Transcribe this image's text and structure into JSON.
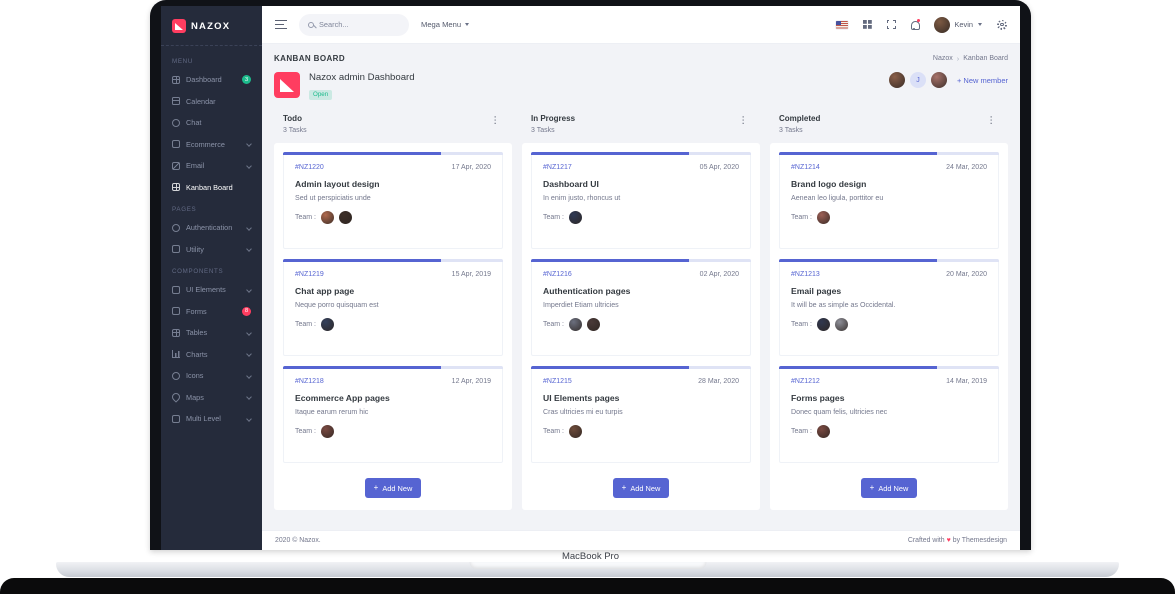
{
  "device": {
    "label": "MacBook Pro"
  },
  "sidebar": {
    "logo_text": "NAZOX",
    "sections": [
      {
        "label": "MENU",
        "items": [
          {
            "label": "Dashboard",
            "icon": "dashboard-icon",
            "icon_style": "grid",
            "badge": "3",
            "badge_color": "#1cbb8c"
          },
          {
            "label": "Calendar",
            "icon": "calendar-icon",
            "icon_style": "cal"
          },
          {
            "label": "Chat",
            "icon": "chat-icon",
            "icon_style": "round"
          },
          {
            "label": "Ecommerce",
            "icon": "ecommerce-icon",
            "icon_style": "",
            "chevron": true
          },
          {
            "label": "Email",
            "icon": "email-icon",
            "icon_style": "mail",
            "chevron": true
          },
          {
            "label": "Kanban Board",
            "icon": "kanban-icon",
            "icon_style": "grid",
            "active": true
          }
        ]
      },
      {
        "label": "PAGES",
        "items": [
          {
            "label": "Authentication",
            "icon": "authentication-icon",
            "icon_style": "round",
            "chevron": true
          },
          {
            "label": "Utility",
            "icon": "utility-icon",
            "icon_style": "",
            "chevron": true
          }
        ]
      },
      {
        "label": "COMPONENTS",
        "items": [
          {
            "label": "UI Elements",
            "icon": "ui-elements-icon",
            "icon_style": "",
            "chevron": true
          },
          {
            "label": "Forms",
            "icon": "forms-icon",
            "icon_style": "",
            "badge": "8",
            "badge_color": "#ff3d60"
          },
          {
            "label": "Tables",
            "icon": "tables-icon",
            "icon_style": "grid",
            "chevron": true
          },
          {
            "label": "Charts",
            "icon": "charts-icon",
            "icon_style": "chart",
            "chevron": true
          },
          {
            "label": "Icons",
            "icon": "icons-icon",
            "icon_style": "round",
            "chevron": true
          },
          {
            "label": "Maps",
            "icon": "maps-icon",
            "icon_style": "pin",
            "chevron": true
          },
          {
            "label": "Multi Level",
            "icon": "multi-level-icon",
            "icon_style": "",
            "chevron": true
          }
        ]
      }
    ]
  },
  "navbar": {
    "search_placeholder": "Search...",
    "mega_menu_label": "Mega Menu",
    "user_name": "Kevin",
    "user_avatar_color": "#7d5a43"
  },
  "page": {
    "title": "KANBAN BOARD",
    "breadcrumb": [
      "Nazox",
      "Kanban Board"
    ],
    "breadcrumb_separator": "›",
    "board_title": "Nazox admin Dashboard",
    "status_badge": "Open",
    "new_member_label": "+ New member",
    "team": [
      {
        "kind": "photo",
        "color": "#8a5e49"
      },
      {
        "kind": "initial",
        "label": "J",
        "bg": "#dbe0f7",
        "color": "#5664d2"
      },
      {
        "kind": "photo",
        "color": "#a8736b"
      }
    ]
  },
  "board": {
    "team_label": "Team :",
    "add_card_label": "Add New",
    "columns": [
      {
        "name": "Todo",
        "count": "3 Tasks",
        "cards": [
          {
            "id": "#NZ1220",
            "date": "17 Apr, 2020",
            "title": "Admin layout design",
            "desc": "Sed ut perspiciatis unde",
            "progress": 72,
            "team": [
              "#b06a4e",
              "#3d2f28"
            ]
          },
          {
            "id": "#NZ1219",
            "date": "15 Apr, 2019",
            "title": "Chat app page",
            "desc": "Neque porro quisquam est",
            "progress": 72,
            "team": [
              "#34415c"
            ]
          },
          {
            "id": "#NZ1218",
            "date": "12 Apr, 2019",
            "title": "Ecommerce App pages",
            "desc": "Itaque earum rerum hic",
            "progress": 72,
            "team": [
              "#7a4a42"
            ]
          }
        ]
      },
      {
        "name": "In Progress",
        "count": "3 Tasks",
        "cards": [
          {
            "id": "#NZ1217",
            "date": "05 Apr, 2020",
            "title": "Dashboard UI",
            "desc": "In enim justo, rhoncus ut",
            "progress": 72,
            "team": [
              "#2f3a55"
            ]
          },
          {
            "id": "#NZ1216",
            "date": "02 Apr, 2020",
            "title": "Authentication pages",
            "desc": "Imperdiet Etiam ultricies",
            "progress": 72,
            "team": [
              "#6b6f7e",
              "#4a3a38"
            ]
          },
          {
            "id": "#NZ1215",
            "date": "28 Mar, 2020",
            "title": "UI Elements pages",
            "desc": "Cras ultricies mi eu turpis",
            "progress": 72,
            "team": [
              "#6d4b3a"
            ]
          }
        ]
      },
      {
        "name": "Completed",
        "count": "3 Tasks",
        "cards": [
          {
            "id": "#NZ1214",
            "date": "24 Mar, 2020",
            "title": "Brand logo design",
            "desc": "Aenean leo ligula, porttitor eu",
            "progress": 72,
            "team": [
              "#9c5f55"
            ]
          },
          {
            "id": "#NZ1213",
            "date": "20 Mar, 2020",
            "title": "Email pages",
            "desc": "It will be as simple as Occidental.",
            "progress": 72,
            "team": [
              "#30384f",
              "#8e8f98"
            ]
          },
          {
            "id": "#NZ1212",
            "date": "14 Mar, 2019",
            "title": "Forms pages",
            "desc": "Donec quam felis, ultricies nec",
            "progress": 72,
            "team": [
              "#7a4a42"
            ]
          }
        ]
      }
    ]
  },
  "footer": {
    "left": "2020 © Nazox.",
    "right_prefix": "Crafted with",
    "heart": "♥",
    "right_suffix": "by Themesdesign"
  },
  "glyphs": {
    "column_menu": "⋮",
    "plus": "+"
  },
  "colors": {
    "primary": "#5664d2",
    "success": "#1cbb8c",
    "danger": "#ff3d60",
    "sidebar_bg": "#252b3b"
  }
}
